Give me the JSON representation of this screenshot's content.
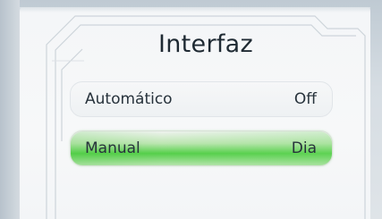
{
  "menu": {
    "title": "Interfaz",
    "items": [
      {
        "label": "Automático",
        "value": "Off",
        "selected": false
      },
      {
        "label": "Manual",
        "value": "Dia",
        "selected": true
      }
    ]
  },
  "colors": {
    "selection_highlight": "#55cf4a",
    "text": "#27323b",
    "screen_background": "#f5f7f8"
  }
}
